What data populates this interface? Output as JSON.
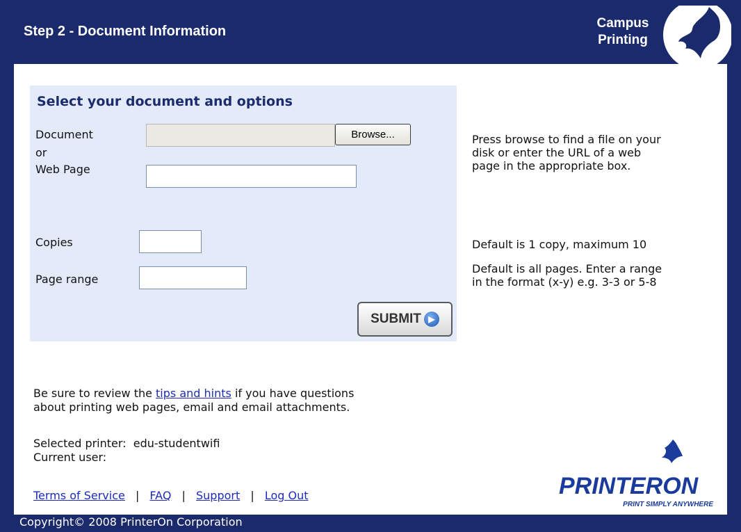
{
  "header": {
    "title": "Step 2 - Document Information",
    "brand_line1": "Campus",
    "brand_line2": "Printing"
  },
  "form": {
    "heading": "Select your document and options",
    "document_label": "Document",
    "or_label": "or",
    "webpage_label": "Web Page",
    "browse_label": "Browse...",
    "document_value": "",
    "webpage_value": "",
    "copies_label": "Copies",
    "copies_value": "",
    "page_range_label": "Page range",
    "page_range_value": "",
    "submit_label": "SUBMIT"
  },
  "help": {
    "document_help_1": "Press browse to find a file on your",
    "document_help_2": "disk or enter the URL of a web",
    "document_help_3": "page in the appropriate box.",
    "copies_help": "Default is 1 copy, maximum 10",
    "range_help_1": "Default is all pages. Enter a range",
    "range_help_2": "in the format (x-y) e.g. 3-3 or 5-8"
  },
  "info": {
    "tips_prefix": "Be sure to review the ",
    "tips_link": "tips and hints",
    "tips_suffix": " if you have questions",
    "tips_line2": "about printing web pages, email and email attachments.",
    "printer_label": "Selected printer:",
    "printer_value": "edu-studentwifi",
    "user_label": "Current user:",
    "user_value": ""
  },
  "footer": {
    "links": [
      "Terms of Service",
      "FAQ",
      "Support",
      "Log Out"
    ],
    "separator": "|",
    "copyright": "Copyright© 2008 PrinterOn Corporation"
  },
  "logo": {
    "name": "PRINTERON",
    "tagline": "PRINT SIMPLY ANYWHERE"
  },
  "colors": {
    "header_bg": "#1a2a6c",
    "panel_bg": "#e3ebfb",
    "link": "#1f2bb8",
    "logo_blue": "#1a3a9c"
  }
}
